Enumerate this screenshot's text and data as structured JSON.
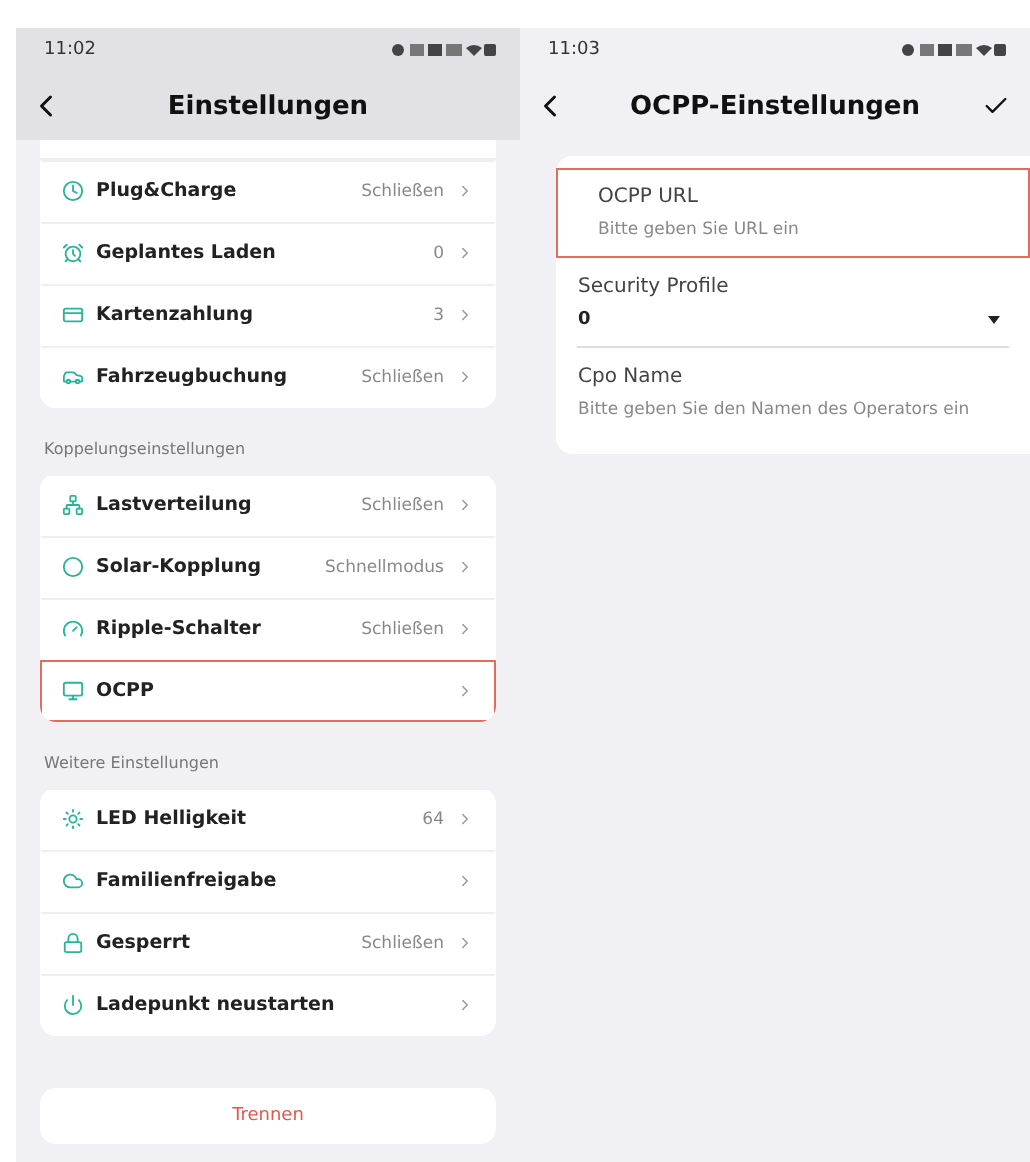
{
  "left_screen": {
    "status_bar": {
      "time": "11:02"
    },
    "header": {
      "title": "Einstellungen"
    },
    "sections": [
      {
        "partial_top": true,
        "items": [
          {
            "label": "Plug&Charge",
            "value": "Schließen",
            "highlighted": false
          },
          {
            "label": "Geplantes Laden",
            "value": "0",
            "highlighted": false
          },
          {
            "label": "Kartenzahlung",
            "value": "3",
            "highlighted": false
          },
          {
            "label": "Fahrzeugbuchung",
            "value": "Schließen",
            "highlighted": false
          }
        ]
      },
      {
        "heading": "Koppelungseinstellungen",
        "items": [
          {
            "label": "Lastverteilung",
            "value": "Schließen",
            "highlighted": false
          },
          {
            "label": "Solar-Kopplung",
            "value": "Schnellmodus",
            "highlighted": false
          },
          {
            "label": "Ripple-Schalter",
            "value": "Schließen",
            "highlighted": false
          },
          {
            "label": "OCPP",
            "value": null,
            "highlighted": true
          }
        ]
      },
      {
        "heading": "Weitere Einstellungen",
        "items": [
          {
            "label": "LED Helligkeit",
            "value": "64",
            "highlighted": false
          },
          {
            "label": "Familienfreigabe",
            "value": null,
            "highlighted": false
          },
          {
            "label": "Gesperrt",
            "value": "Schließen",
            "highlighted": false
          },
          {
            "label": "Ladepunkt neustarten",
            "value": null,
            "highlighted": false
          }
        ]
      }
    ],
    "disconnect_button": "Trennen"
  },
  "right_screen": {
    "status_bar": {
      "time": "11:03"
    },
    "header": {
      "title": "OCPP-Einstellungen"
    },
    "fields": [
      {
        "kind": "text",
        "label": "OCPP URL",
        "placeholder": "Bitte geben Sie URL ein",
        "highlighted": true
      },
      {
        "kind": "select",
        "label": "Security Profile",
        "value": "0",
        "highlighted": false
      },
      {
        "kind": "text",
        "label": "Cpo Name",
        "placeholder": "Bitte geben Sie den Namen des Operators ein",
        "highlighted": false
      }
    ]
  }
}
